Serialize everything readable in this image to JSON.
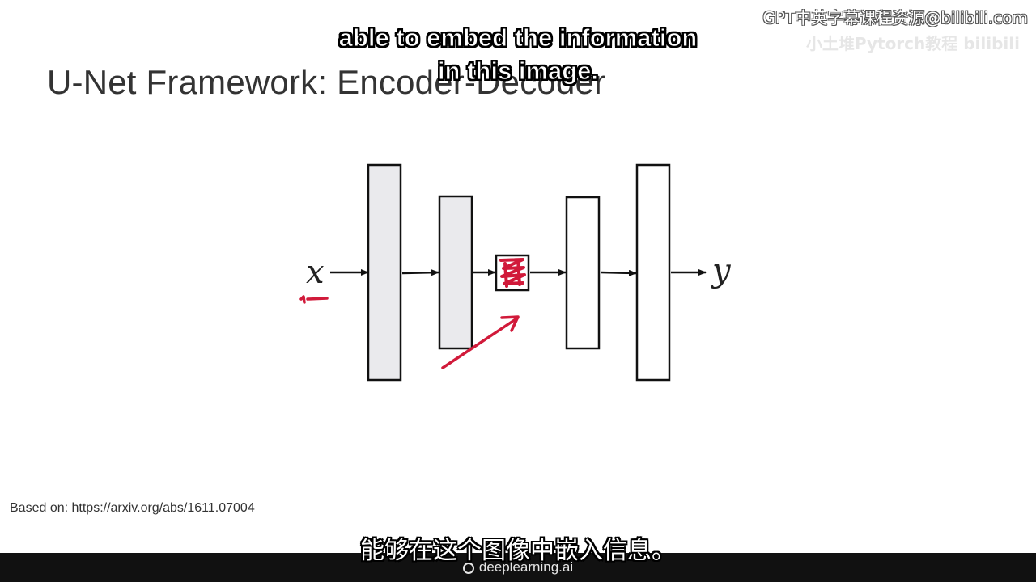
{
  "slide": {
    "title": "U-Net Framework: Encoder-Decoder",
    "source_note": "Based on: https://arxiv.org/abs/1611.07004"
  },
  "diagram": {
    "input_label": "x",
    "output_label": "y",
    "layers": [
      {
        "name": "encoder-layer-1",
        "fill": "#eaeaed"
      },
      {
        "name": "encoder-layer-2",
        "fill": "#eaeaed"
      },
      {
        "name": "bottleneck",
        "fill": "#ffffff"
      },
      {
        "name": "decoder-layer-1",
        "fill": "#ffffff"
      },
      {
        "name": "decoder-layer-2",
        "fill": "#ffffff"
      }
    ],
    "annotation_color": "#d11a3a"
  },
  "captions": {
    "english_line1": "able to embed the information",
    "english_line2": "in this image.",
    "chinese": "能够在这个图像中嵌入信息。"
  },
  "watermark": {
    "text": "GPT中英字幕课程资源@bilibili.com",
    "ghost_text": "小土堆Pytorch教程  bilibili"
  },
  "branding": {
    "text": "deeplearning.ai",
    "icon": "deeplearning-logo-icon"
  }
}
